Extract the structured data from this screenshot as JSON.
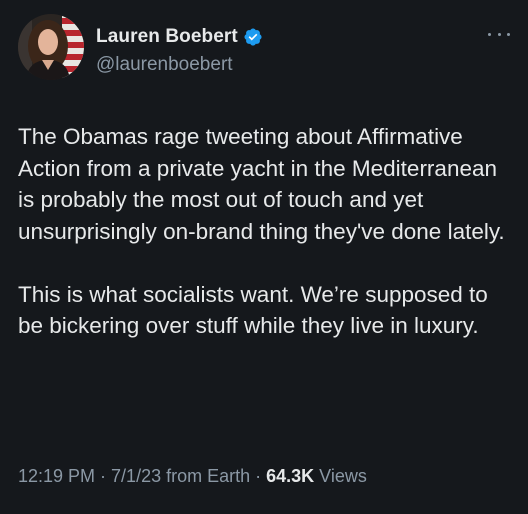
{
  "author": {
    "display_name": "Lauren Boebert",
    "handle": "@laurenboebert",
    "verified": true
  },
  "icons": {
    "avatar": "profile-photo",
    "verified": "verified-badge-icon",
    "more": "more-options-icon"
  },
  "colors": {
    "background": "#15181c",
    "text": "#e7e9ea",
    "secondary": "#8b98a5",
    "verified_blue": "#1d9bf0"
  },
  "tweet": {
    "paragraphs": [
      "The Obamas rage tweeting about Affirmative Action from a private yacht in the Mediterranean is probably the most out of touch and yet unsurprisingly on-brand thing they've done lately.",
      "This is what socialists want. We’re supposed to be bickering over stuff while they live in luxury."
    ]
  },
  "meta": {
    "time": "12:19 PM",
    "sep1": " · ",
    "date": "7/1/23",
    "source": " from Earth",
    "sep2": " · ",
    "views_count": "64.3K",
    "views_label": " Views"
  }
}
